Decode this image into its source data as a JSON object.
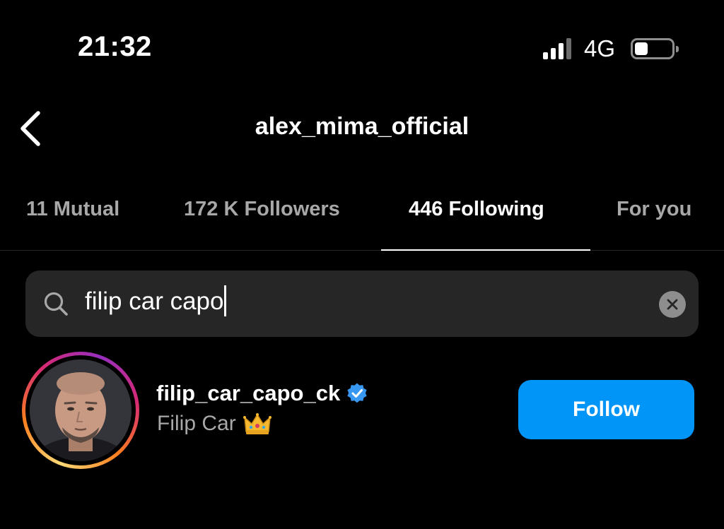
{
  "status_bar": {
    "time": "21:32",
    "network": "4G",
    "battery_level": 0.35
  },
  "header": {
    "title": "alex_mima_official"
  },
  "tabs": [
    {
      "label": "11 Mutual",
      "active": false
    },
    {
      "label": "172 K Followers",
      "active": false
    },
    {
      "label": "446 Following",
      "active": true
    },
    {
      "label": "For you",
      "active": false
    }
  ],
  "search": {
    "value": "filip car capo"
  },
  "results": [
    {
      "username": "filip_car_capo_ck",
      "full_name": "Filip Car",
      "verified": true,
      "button_label": "Follow"
    }
  ],
  "colors": {
    "background": "#000000",
    "accent": "#0095f6",
    "secondary_text": "#a8a8a8",
    "search_background": "#262626",
    "verified_badge": "#3897f0"
  }
}
